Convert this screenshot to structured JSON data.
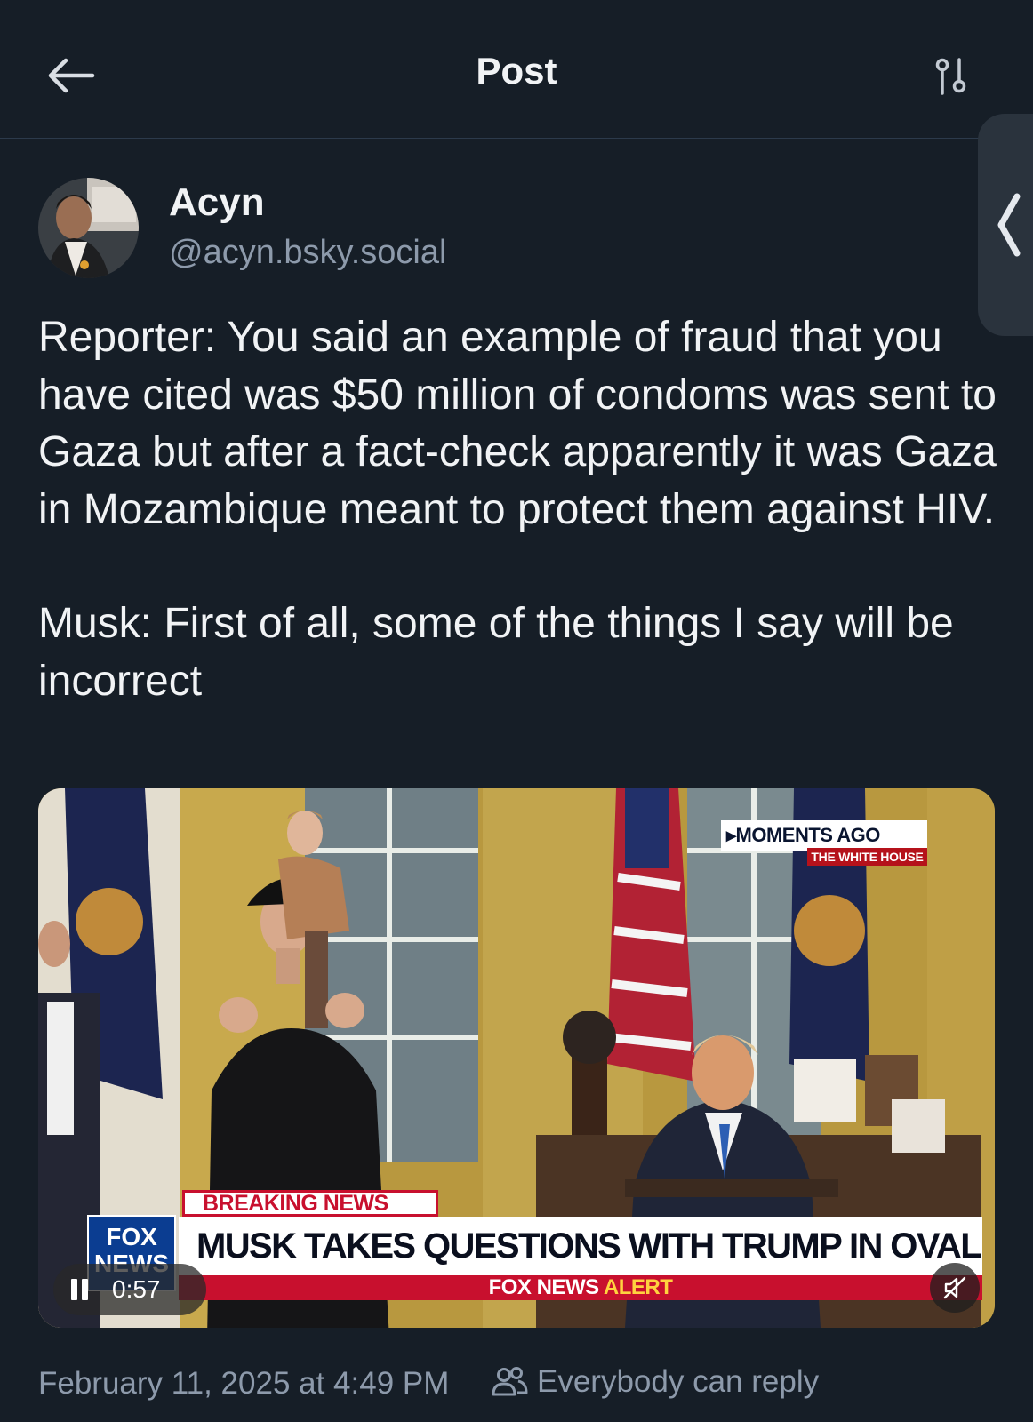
{
  "header": {
    "title": "Post",
    "back_icon": "arrow-left-icon",
    "settings_icon": "sliders-icon"
  },
  "author": {
    "name": "Acyn",
    "handle": "@acyn.bsky.social"
  },
  "post": {
    "paragraphs": [
      "Reporter: You said an example of fraud that you have cited was $50 million of condoms was sent to Gaza but after a fact-check apparently it was Gaza in Mozambique meant to protect them against HIV.",
      "Musk: First of all, some of the things I say will be incorrect"
    ],
    "timestamp": "February 11, 2025 at 4:49 PM",
    "reply_setting": "Everybody can reply"
  },
  "video": {
    "time": "0:57",
    "moments_label": "▸MOMENTS AGO",
    "location_label": "THE WHITE HOUSE",
    "breaking_label": "BREAKING",
    "breaking_news_word": "NEWS",
    "logo_top": "FOX",
    "logo_bottom": "NEWS",
    "headline": "MUSK TAKES QUESTIONS WITH TRUMP IN OVAL OFFICE",
    "alert_prefix": "FOX NEWS",
    "alert_word": "ALERT"
  },
  "colors": {
    "background": "#161e27",
    "text_primary": "#f1f3f5",
    "text_secondary": "#8d9aab",
    "fox_red": "#c8102e",
    "fox_blue": "#0b3d91"
  }
}
